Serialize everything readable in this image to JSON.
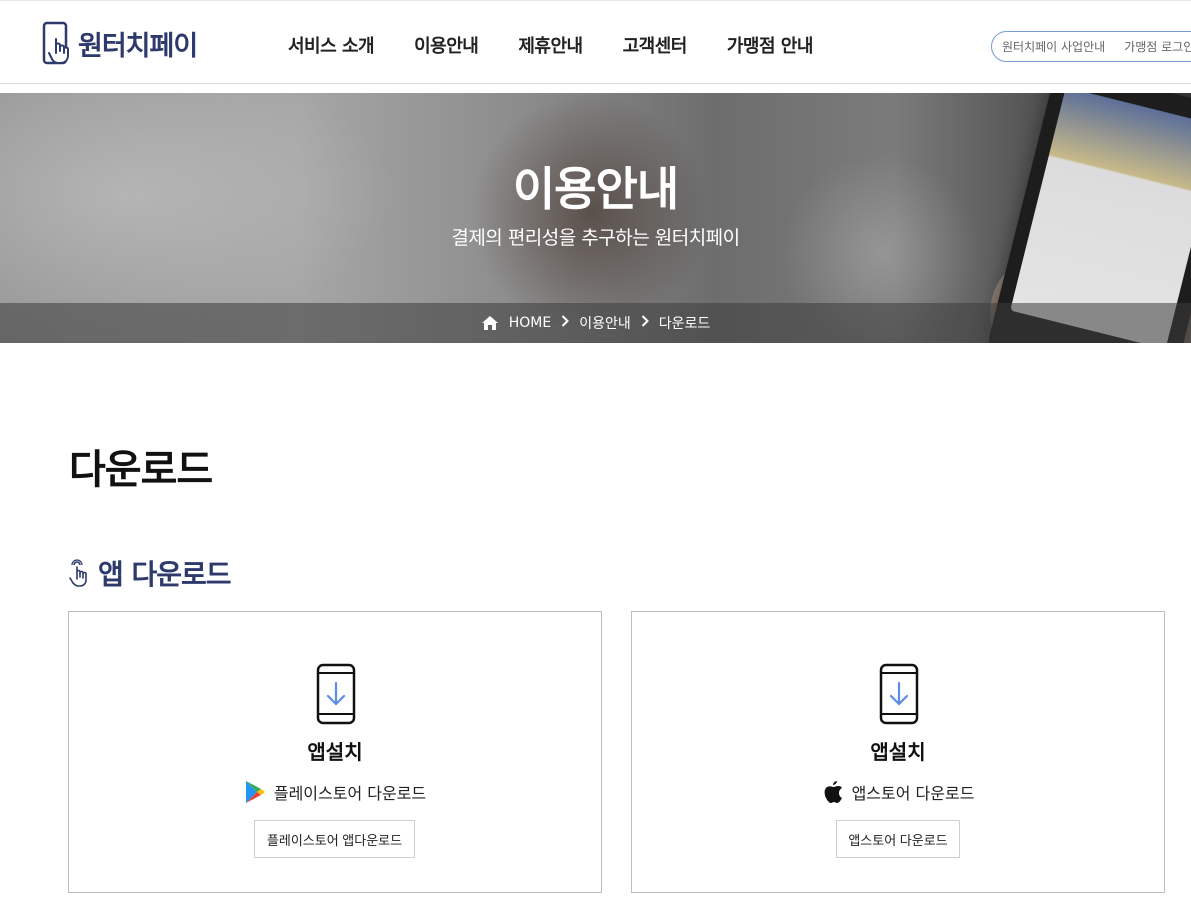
{
  "header": {
    "logo_text": "원터치페이",
    "nav": [
      "서비스 소개",
      "이용안내",
      "제휴안내",
      "고객센터",
      "가맹점 안내"
    ],
    "util_links": [
      "원터치페이 사업안내",
      "가맹점 로그인"
    ]
  },
  "banner": {
    "title": "이용안내",
    "subtitle": "결제의 편리성을 추구하는 원터치페이",
    "breadcrumb": [
      "HOME",
      "이용안내",
      "다운로드"
    ]
  },
  "main": {
    "page_title": "다운로드",
    "section_title": "앱 다운로드",
    "cards": [
      {
        "title": "앱설치",
        "store_label": "플레이스토어 다운로드",
        "button_label": "플레이스토어 앱다운로드",
        "store_icon": "google-play-icon"
      },
      {
        "title": "앱설치",
        "store_label": "앱스토어 다운로드",
        "button_label": "앱스토어 다운로드",
        "store_icon": "apple-icon"
      }
    ]
  },
  "colors": {
    "brand_navy": "#2d3a6b",
    "download_arrow": "#5b8de6",
    "util_border": "#7a9ad6"
  }
}
